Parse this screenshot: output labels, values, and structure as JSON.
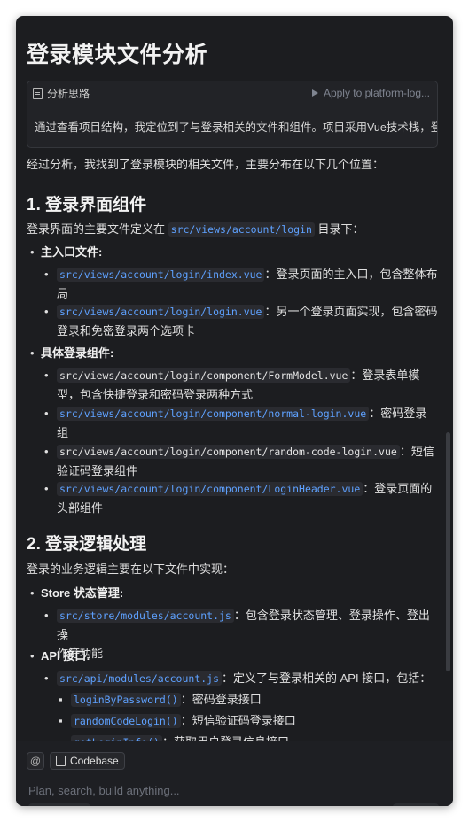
{
  "title": "登录模块文件分析",
  "analysis": {
    "label": "分析思路",
    "apply": "Apply to platform-log...",
    "text": "通过查看项目结构，我定位到了与登录相关的文件和组件。项目采用Vue技术栈，登录"
  },
  "intro": "经过分析，我找到了登录模块的相关文件，主要分布在以下几个位置：",
  "section1": {
    "heading": "1. 登录界面组件",
    "desc_prefix": "登录界面的主要文件定义在",
    "desc_code": "src/views/account/login",
    "desc_suffix": "目录下：",
    "group1_label": "主入口文件",
    "group1_items": [
      {
        "code": "src/views/account/login/index.vue",
        "text_line1": "：登录页面的主入口，包含整体布",
        "text_line2": "局"
      },
      {
        "code": "src/views/account/login/login.vue",
        "text_line1": "：另一个登录页面实现，包含密码",
        "text_line2": "登录和免密登录两个选项卡"
      }
    ],
    "group2_label": "具体登录组件",
    "group2_items": [
      {
        "code": "src/views/account/login/component/FormModel.vue",
        "text_line1": "：登录表单模",
        "text_line2": "型，包含快捷登录和密码登录两种方式"
      },
      {
        "code": "src/views/account/login/component/normal-login.vue",
        "text_line1": "：密码登录组",
        "text_line2": "件"
      },
      {
        "code": "src/views/account/login/component/random-code-login.vue",
        "text_line1": "：短信",
        "text_line2": "验证码登录组件"
      },
      {
        "code": "src/views/account/login/component/LoginHeader.vue",
        "text_line1": "：登录页面的",
        "text_line2": "头部组件"
      }
    ]
  },
  "section2": {
    "heading": "2. 登录逻辑处理",
    "desc": "登录的业务逻辑主要在以下文件中实现：",
    "store_label": "Store 状态管理",
    "store_item": {
      "code": "src/store/modules/account.js",
      "text_line1": "：包含登录状态管理、登录操作、登出操",
      "text_line2": "作等功能"
    },
    "api_label": "API 接口",
    "api_item": {
      "code": "src/api/modules/account.js",
      "text": "：定义了与登录相关的 API 接口，包括："
    },
    "api_sub": [
      {
        "code": "loginByPassword()",
        "text": "：密码登录接口"
      },
      {
        "code": "randomCodeLogin()",
        "text": "：短信验证码登录接口"
      },
      {
        "code": "getLoginInfo()",
        "text": "：获取用户登录信息接口"
      }
    ]
  },
  "composer": {
    "at": "@",
    "codebase": "Codebase",
    "placeholder": "Plan, search, build anything..."
  },
  "colors": {
    "background": "#1c1d20",
    "code_blue": "#5ea1ff"
  }
}
